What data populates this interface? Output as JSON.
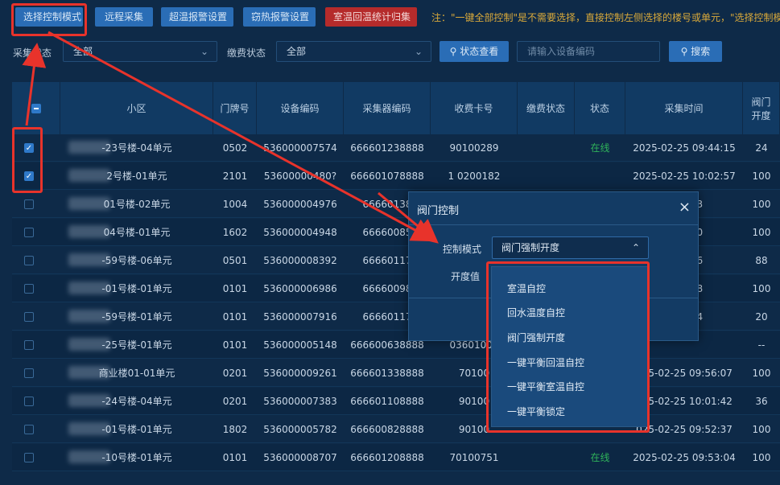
{
  "toolbar": {
    "select_mode": "选择控制模式",
    "remote_collect": "远程采集",
    "over_temp_alarm": "超温报警设置",
    "steal_heat_alarm": "窃热报警设置",
    "indoor_return_stats": "室温回温统计归集",
    "notice": "注：\"一键全部控制\"是不需要选择，直接控制左侧选择的楼号或单元，\"选择控制模式\"",
    "colors": {
      "primary": "#2a6db6",
      "danger": "#b52b2b",
      "notice": "#d9a93a"
    }
  },
  "filters": {
    "collect_status_label": "采集状态",
    "collect_status_value": "全部",
    "pay_status_label": "缴费状态",
    "pay_status_value": "全部",
    "status_view_button": "状态查看",
    "search_placeholder": "请输入设备编码",
    "search_button": "搜索"
  },
  "table": {
    "headers": [
      "小区",
      "门牌号",
      "设备编码",
      "采集器编码",
      "收费卡号",
      "缴费状态",
      "状态",
      "采集时间",
      "阀门\n开度"
    ],
    "rows": [
      {
        "checked": true,
        "community": "-23号楼-04单元",
        "door": "0502",
        "device": "536000007574",
        "collector": "666601238888",
        "card": "90100289",
        "pay": "",
        "status": "在线",
        "time": "2025-02-25 09:44:15",
        "valve": "24"
      },
      {
        "checked": true,
        "community": "2号楼-01单元",
        "door": "2101",
        "device": "53600000480?",
        "collector": "666601078888",
        "card": "1  0200182",
        "pay": "",
        "status": "",
        "time": "2025-02-25 10:02:57",
        "valve": "100"
      },
      {
        "checked": false,
        "community": "01号楼-02单元",
        "door": "1004",
        "device": "536000004976",
        "collector": "66660138",
        "card": "",
        "pay": "",
        "status": "",
        "time": "0:01:03",
        "valve": "100"
      },
      {
        "checked": false,
        "community": "04号楼-01单元",
        "door": "1602",
        "device": "536000004948",
        "collector": "66660085",
        "card": "",
        "pay": "",
        "status": "",
        "time": "9:51:20",
        "valve": "100"
      },
      {
        "checked": false,
        "community": "-59号楼-06单元",
        "door": "0501",
        "device": "536000008392",
        "collector": "66660117",
        "card": "",
        "pay": "",
        "status": "",
        "time": "0:03:06",
        "valve": "88"
      },
      {
        "checked": false,
        "community": "-01号楼-01单元",
        "door": "0101",
        "device": "536000006986",
        "collector": "66660098",
        "card": "",
        "pay": "",
        "status": "",
        "time": "9:48:28",
        "valve": "100"
      },
      {
        "checked": false,
        "community": "-59号楼-01单元",
        "door": "0101",
        "device": "536000007916",
        "collector": "66660117",
        "card": "",
        "pay": "",
        "status": "",
        "time": "9:55:44",
        "valve": "20"
      },
      {
        "checked": false,
        "community": "-25号楼-01单元",
        "door": "0101",
        "device": "536000005148",
        "collector": "666600638888",
        "card": "03601004",
        "pay": "",
        "status": "",
        "time": "",
        "valve": "--"
      },
      {
        "checked": false,
        "community": "商业楼01-01单元",
        "door": "0201",
        "device": "536000009261",
        "collector": "666601338888",
        "card": "70100",
        "pay": "",
        "status": "",
        "time": "025-02-25 09:56:07",
        "valve": "100"
      },
      {
        "checked": false,
        "community": "-24号楼-04单元",
        "door": "0201",
        "device": "536000007383",
        "collector": "666601108888",
        "card": "90100",
        "pay": "",
        "status": "",
        "time": "025-02-25 10:01:42",
        "valve": "36"
      },
      {
        "checked": false,
        "community": "-01号楼-01单元",
        "door": "1802",
        "device": "536000005782",
        "collector": "666600828888",
        "card": "90100",
        "pay": "",
        "status": "",
        "time": "025-02-25 09:52:37",
        "valve": "100"
      },
      {
        "checked": false,
        "community": "-10号楼-01单元",
        "door": "0101",
        "device": "536000008707",
        "collector": "666601208888",
        "card": "70100751",
        "pay": "",
        "status": "在线",
        "time": "2025-02-25 09:53:04",
        "valve": "100"
      }
    ]
  },
  "modal": {
    "title": "阀门控制",
    "mode_label": "控制模式",
    "mode_value": "阀门强制开度",
    "opening_label": "开度值",
    "options": [
      "室温自控",
      "回水温度自控",
      "阀门强制开度",
      "一键平衡回温自控",
      "一键平衡室温自控",
      "一键平衡锁定"
    ]
  },
  "annotation_color": "#e8332b"
}
